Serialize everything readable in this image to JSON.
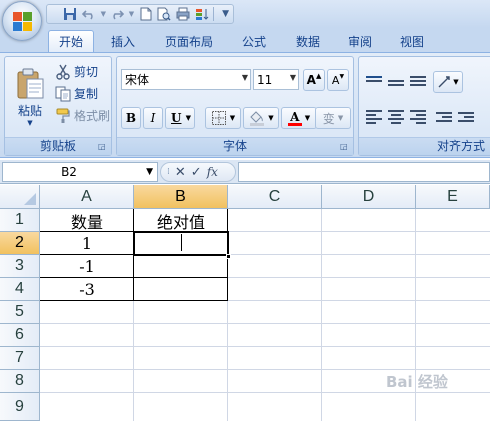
{
  "ribbon": {
    "tabs": [
      "开始",
      "插入",
      "页面布局",
      "公式",
      "数据",
      "审阅",
      "视图"
    ],
    "active_tab": "开始",
    "clipboard": {
      "paste_label": "粘贴",
      "cut_label": "剪切",
      "copy_label": "复制",
      "format_painter_label": "格式刷",
      "group_label": "剪贴板"
    },
    "font": {
      "font_name": "宋体",
      "font_size": "11",
      "bold_label": "B",
      "italic_label": "I",
      "underline_label": "U",
      "grow_label": "A",
      "shrink_label": "A",
      "font_color_label": "A",
      "phonetic_label": "变",
      "group_label": "字体"
    },
    "alignment": {
      "group_label": "对齐方式"
    }
  },
  "formula_bar": {
    "name_box": "B2",
    "cancel_symbol": "✕",
    "enter_symbol": "✓",
    "fx_label": "fx",
    "formula_value": ""
  },
  "sheet": {
    "columns": [
      "A",
      "B",
      "C",
      "D",
      "E"
    ],
    "selected_column": "B",
    "rows": [
      "1",
      "2",
      "3",
      "4",
      "5",
      "6",
      "7",
      "8",
      "9"
    ],
    "selected_row": "2",
    "active_cell": "B2",
    "cells": {
      "A1": "数量",
      "B1": "绝对值",
      "A2": "1",
      "A3": "-1",
      "A4": "-3"
    }
  },
  "watermark_text": "Bai 经验",
  "colors": {
    "header_selected": "#f1c15f",
    "ribbon_text": "#15428b",
    "font_color_bar": "#ff0000",
    "grid_line": "#d0d7e5"
  }
}
